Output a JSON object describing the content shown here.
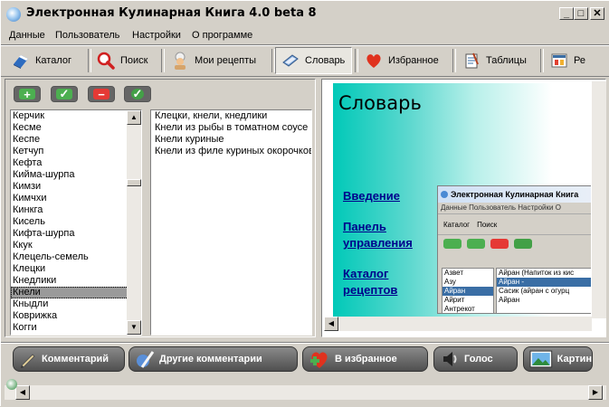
{
  "window": {
    "title": "Электронная Кулинарная Книга 4.0 beta 8",
    "controls": {
      "minimize": "_",
      "maximize": "□",
      "close": "✕"
    }
  },
  "menu": [
    "Данные",
    "Пользователь",
    "Настройки",
    "О программе"
  ],
  "toolbar": [
    {
      "label": "Каталог",
      "icon": "book-icon"
    },
    {
      "label": "Поиск",
      "icon": "search-icon"
    },
    {
      "label": "Мои рецепты",
      "icon": "chef-icon"
    },
    {
      "label": "Словарь",
      "icon": "dictionary-icon",
      "active": true
    },
    {
      "label": "Избранное",
      "icon": "heart-icon"
    },
    {
      "label": "Таблицы",
      "icon": "notepad-icon"
    },
    {
      "label": "Ре",
      "icon": "recipe-icon"
    }
  ],
  "action_buttons": [
    {
      "name": "add-button",
      "symbol": "+",
      "color": "#4caf50"
    },
    {
      "name": "confirm-button",
      "symbol": "✓",
      "color": "#4caf50"
    },
    {
      "name": "remove-button",
      "symbol": "−",
      "color": "#e53935"
    },
    {
      "name": "approve-button",
      "symbol": "✓",
      "color": "#43a047"
    }
  ],
  "terms": [
    "Керчик",
    "Кесме",
    "Кеспе",
    "Кетчуп",
    "Кефта",
    "Кийма-шурпа",
    "Кимзи",
    "Кимчхи",
    "Кинкга",
    "Кисель",
    "Кифта-шурпа",
    "Ккук",
    "Клецель-семель",
    "Клецки",
    "Кнедлики",
    "Кнели",
    "Кныдли",
    "Коврижка",
    "Когги"
  ],
  "selected_term": "Кнели",
  "recipes": [
    "Клецки, кнели, кнедлики",
    "Кнели из рыбы в томатном соусе",
    "Кнели куриные",
    "Кнели из филе куриных окорочков"
  ],
  "dictionary": {
    "title": "Словарь",
    "links": [
      {
        "line1": "Введение",
        "line2": ""
      },
      {
        "line1": "Панель",
        "line2": "управления"
      },
      {
        "line1": "Каталог",
        "line2": "рецептов"
      }
    ]
  },
  "preview": {
    "title": "Электронная Кулинарная Книга",
    "menu": "Данные   Пользователь   Настройки   О",
    "tabs": [
      "Каталог",
      "Поиск"
    ],
    "terms": [
      "Азвет",
      "Азу",
      "Айран",
      "Айрит",
      "Антрекот"
    ],
    "selected_term": "Айран",
    "recipes": [
      "Айран (Напиток из кис",
      "Айран -",
      "Сасик (айран с огурц",
      "Айран"
    ],
    "selected_recipe": "Айран -"
  },
  "bottom_buttons": [
    {
      "label": "Комментарий",
      "icon": "pen-icon"
    },
    {
      "label": "Другие комментарии",
      "icon": "feather-icon"
    },
    {
      "label": "В избранное",
      "icon": "heart-plus-icon"
    },
    {
      "label": "Голос",
      "icon": "voice-icon"
    },
    {
      "label": "Картин",
      "icon": "picture-icon"
    }
  ]
}
